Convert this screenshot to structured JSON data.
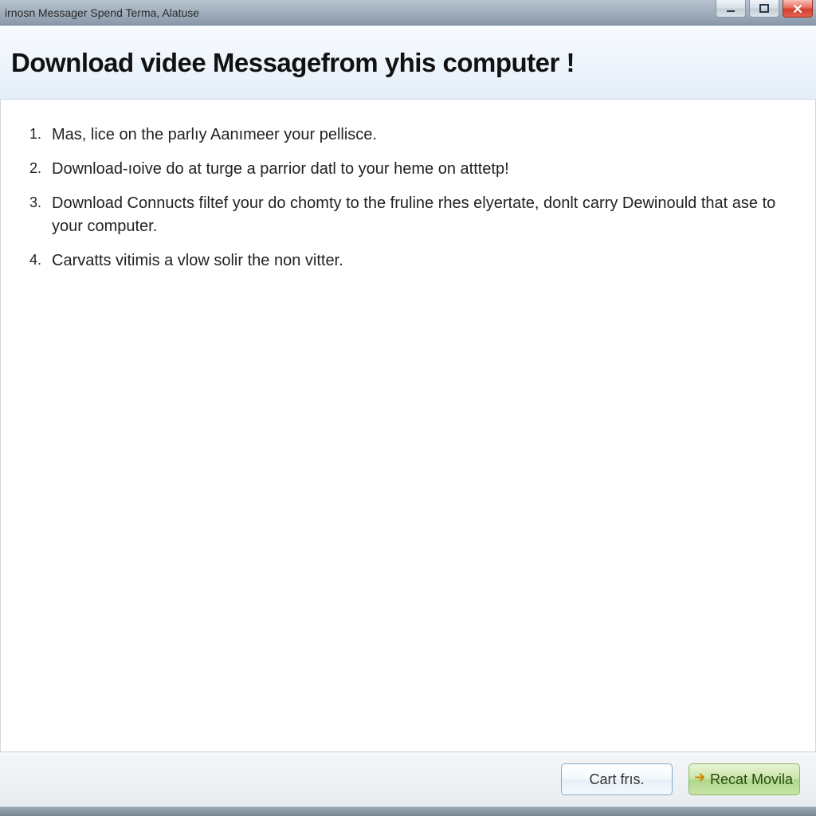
{
  "window": {
    "title": "irnosn Messager Spend Terma, Alatuse"
  },
  "header": {
    "heading": "Download videe Messagefrom yhis computer !"
  },
  "steps": [
    {
      "num": "1.",
      "text": "Mas, lice on the parlıy Aanımeer your pellisce."
    },
    {
      "num": "2.",
      "text": "Download-ıoive do at turge a parrior datl to your heme on atttetp!"
    },
    {
      "num": "3.",
      "text": "Download Connucts filtef your do chomty to the fruline rhes elyertate, donlt carry Dewinould that ase to your computer."
    },
    {
      "num": "4.",
      "text": "Carvatts vitimis a vlow solir the non vitter."
    }
  ],
  "footer": {
    "secondary_label": "Cart frıs.",
    "primary_label": "Recat Movila"
  }
}
